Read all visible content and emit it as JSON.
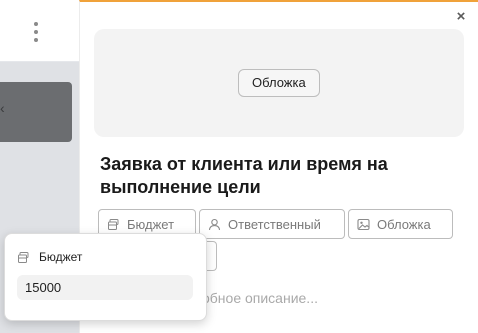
{
  "modal": {
    "cover_button_label": "Обложка",
    "title": "Заявка от клиента или время на выполнение цели",
    "chips": {
      "budget_label": "Бюджет",
      "assignee_label": "Ответственный",
      "cover_label": "Обложка"
    },
    "description_placeholder": "обное описание..."
  },
  "popover": {
    "title": "Бюджет",
    "value": "15000"
  },
  "background": {
    "card_glyph": "‹"
  },
  "icons": {
    "close": "close-icon",
    "kebab": "kebab-icon",
    "budget": "money-icon",
    "assignee": "user-icon",
    "cover": "image-icon"
  },
  "colors": {
    "accent": "#f0a23a",
    "cover_bg": "#f3f3f3",
    "board_bg": "#dfe1e5",
    "card_dark": "#6b6d70"
  }
}
